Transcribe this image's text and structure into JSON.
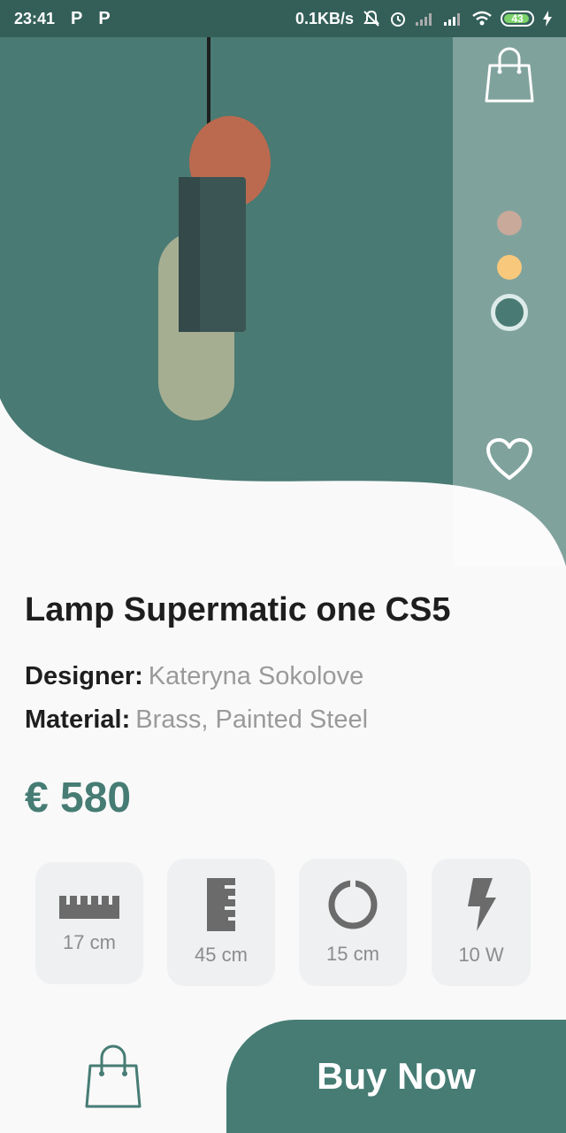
{
  "status_bar": {
    "time": "23:41",
    "carrier_icons": [
      "P",
      "P"
    ],
    "speed": "0.1KB/s",
    "battery": "43",
    "icons": [
      "mute-bell-icon",
      "alarm-icon",
      "signal-icon",
      "signal-icon",
      "wifi-icon",
      "battery-icon",
      "charging-icon"
    ]
  },
  "product": {
    "title": "Lamp Supermatic one CS5",
    "designer_label": "Designer:",
    "designer_value": "Kateryna Sokolove",
    "material_label": "Material:",
    "material_value": "Brass, Painted Steel",
    "price": "€ 580"
  },
  "swatches": [
    "#c8a99a",
    "#f8c97c",
    "#497a73"
  ],
  "features": [
    {
      "icon": "ruler-horizontal-icon",
      "label": "17 cm"
    },
    {
      "icon": "ruler-vertical-icon",
      "label": "45 cm"
    },
    {
      "icon": "circle-diameter-icon",
      "label": "15 cm"
    },
    {
      "icon": "lightning-icon",
      "label": "10 W"
    }
  ],
  "actions": {
    "buy_label": "Buy Now"
  },
  "colors": {
    "accent": "#467c74",
    "status_bar": "#345f59",
    "background": "#f9f9f9"
  }
}
